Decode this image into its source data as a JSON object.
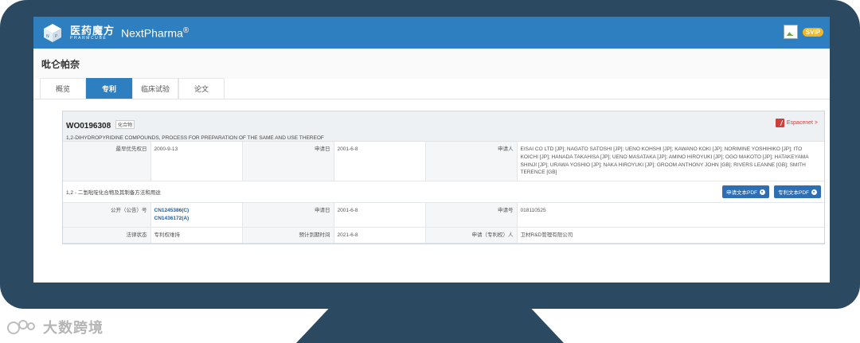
{
  "header": {
    "brand_cn": "医药魔方",
    "brand_sub": "PHARMCUBE",
    "brand_en": "NextPharma",
    "brand_reg": "®",
    "svip_label": "SVIP",
    "accent": "#2d7fc0"
  },
  "page_title": "吡仑帕奈",
  "tabs": [
    {
      "label": "概览",
      "active": false
    },
    {
      "label": "专利",
      "active": true
    },
    {
      "label": "临床试验",
      "active": false
    },
    {
      "label": "论文",
      "active": false
    }
  ],
  "patent": {
    "number": "WO0196308",
    "tag": "化合物",
    "title": "1,2-DIHYDROPYRIDINE COMPOUNDS, PROCESS FOR PREPARATION OF THE SAME AND USE THEREOF",
    "espacenet": "Espacenet >",
    "row1": {
      "priority_label": "最早优先权日",
      "priority_value": "2000-9-13",
      "filed_label": "申请日",
      "filed_value": "2001-6-8",
      "applicant_label": "申请人",
      "applicant_value": "EISAI CO LTD [JP]; NAGATO SATOSHI [JP]; UENO KOHSHI [JP]; KAWANO KOKI [JP]; NORIMINE YOSHIHIKO [JP]; ITO KOICHI [JP]; HANADA TAKAHISA [JP]; UENO MASATAKA [JP]; AMINO HIROYUKI [JP]; OGO MAKOTO [JP]; HATAKEYAMA SHINJI [JP]; URAWA YOSHIO [JP]; NAKA HIROYUKI [JP]; GROOM ANTHONY JOHN [GB]; RIVERS LEANNE [GB]; SMITH TERENCE [GB]"
    },
    "cn_title": "1,2 - 二氢吡啶化合物及其制备方法和用途",
    "btn_application_pdf": "申请文本PDF",
    "btn_patent_pdf": "专利文本PDF",
    "row2": {
      "pub_label": "公开（公告）号",
      "pub_value_1": "CN1245386(C)",
      "pub_value_2": "CN1436172(A)",
      "filed_label": "申请日",
      "filed_value": "2001-6-8",
      "appno_label": "申请号",
      "appno_value": "018110525"
    },
    "row3": {
      "legal_label": "法律状态",
      "legal_value": "专利权维持",
      "expiry_label": "预计到期时间",
      "expiry_value": "2021-6-8",
      "holder_label": "申请（专利权）人",
      "holder_value": "卫材R&D管理有限公司"
    }
  },
  "watermark": "大数跨境"
}
